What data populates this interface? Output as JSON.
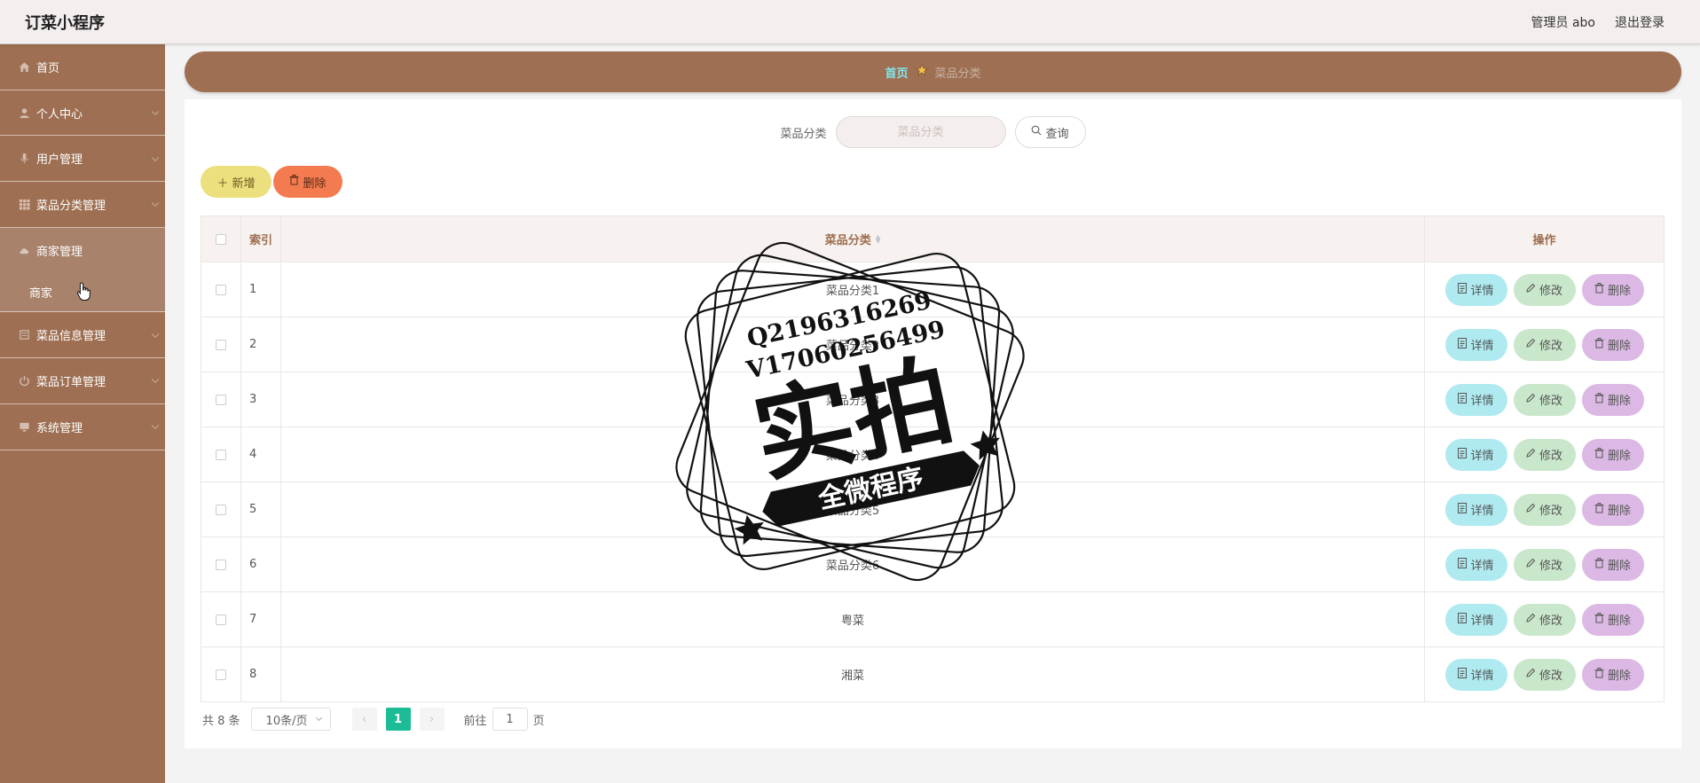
{
  "app": {
    "title": "订菜小程序"
  },
  "header": {
    "admin_label": "管理员 abo",
    "logout": "退出登录"
  },
  "sidebar": {
    "items": [
      {
        "label": "首页",
        "icon": "home-icon"
      },
      {
        "label": "个人中心",
        "icon": "user-icon"
      },
      {
        "label": "用户管理",
        "icon": "mic-icon"
      },
      {
        "label": "菜品分类管理",
        "icon": "grid-icon"
      },
      {
        "label": "商家管理",
        "icon": "cloud-icon"
      },
      {
        "label": "菜品信息管理",
        "icon": "list-icon"
      },
      {
        "label": "菜品订单管理",
        "icon": "power-icon"
      },
      {
        "label": "系统管理",
        "icon": "monitor-icon"
      }
    ],
    "submenu": {
      "label": "商家"
    }
  },
  "breadcrumb": {
    "home": "首页",
    "current": "菜品分类"
  },
  "search": {
    "label": "菜品分类",
    "placeholder": "菜品分类",
    "button": "查询"
  },
  "actions": {
    "add": "新增",
    "delete": "删除"
  },
  "table": {
    "headers": {
      "index": "索引",
      "name": "菜品分类",
      "ops": "操作"
    },
    "rows": [
      {
        "index": "1",
        "name": "菜品分类1"
      },
      {
        "index": "2",
        "name": "菜品分类2"
      },
      {
        "index": "3",
        "name": "菜品分类3"
      },
      {
        "index": "4",
        "name": "菜品分类4"
      },
      {
        "index": "5",
        "name": "菜品分类5"
      },
      {
        "index": "6",
        "name": "菜品分类6"
      },
      {
        "index": "7",
        "name": "粤菜"
      },
      {
        "index": "8",
        "name": "湘菜"
      }
    ],
    "ops": {
      "detail": "详情",
      "edit": "修改",
      "delete": "删除"
    }
  },
  "pagination": {
    "total": "共 8 条",
    "page_size": "10条/页",
    "current_page": "1",
    "goto_label": "前往",
    "goto_value": "1",
    "page_suffix": "页"
  },
  "watermark": {
    "line1": "Q2196316269",
    "line2": "V17060256499",
    "main": "实拍",
    "banner": "全微程序"
  },
  "colors": {
    "brand": "#9e6f52",
    "breadcrumb_home": "#7fe7ee",
    "add_button": "#ece07e",
    "delete_button": "#f47b4f",
    "detail_button": "#aeeaf0",
    "edit_button": "#c9e7cb",
    "row_delete_button": "#dcb9e4",
    "page_active": "#1bbc96"
  }
}
